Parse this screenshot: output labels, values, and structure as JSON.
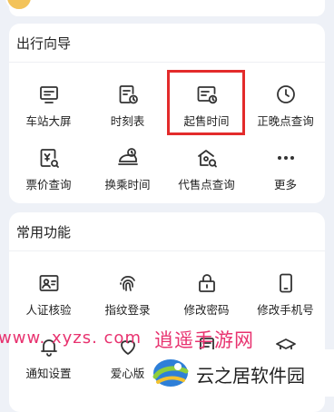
{
  "travel_guide": {
    "title": "出行向导",
    "items": [
      {
        "label": "车站大屏",
        "icon": "station-screen-icon"
      },
      {
        "label": "时刻表",
        "icon": "timetable-icon"
      },
      {
        "label": "起售时间",
        "icon": "sale-time-icon"
      },
      {
        "label": "正晚点查询",
        "icon": "clock-icon"
      },
      {
        "label": "票价查询",
        "icon": "fare-icon"
      },
      {
        "label": "换乘时间",
        "icon": "transfer-icon"
      },
      {
        "label": "代售点查询",
        "icon": "agency-icon"
      },
      {
        "label": "更多",
        "icon": "more-icon"
      }
    ]
  },
  "common_functions": {
    "title": "常用功能",
    "items": [
      {
        "label": "人证核验",
        "icon": "id-card-icon"
      },
      {
        "label": "指纹登录",
        "icon": "fingerprint-icon"
      },
      {
        "label": "修改密码",
        "icon": "lock-icon"
      },
      {
        "label": "修改手机号",
        "icon": "phone-icon"
      },
      {
        "label": "通知设置",
        "icon": "bell-icon"
      },
      {
        "label": "爱心版",
        "icon": "heart-icon"
      }
    ]
  },
  "watermark": {
    "url": "www. xyzs. com",
    "site_name": "逍遥手游网"
  },
  "corner_logo": {
    "name": "云之居软件园"
  },
  "colors": {
    "highlight_border": "#e32b2b",
    "watermark": "#e8326f",
    "background": "#eef1f7"
  }
}
